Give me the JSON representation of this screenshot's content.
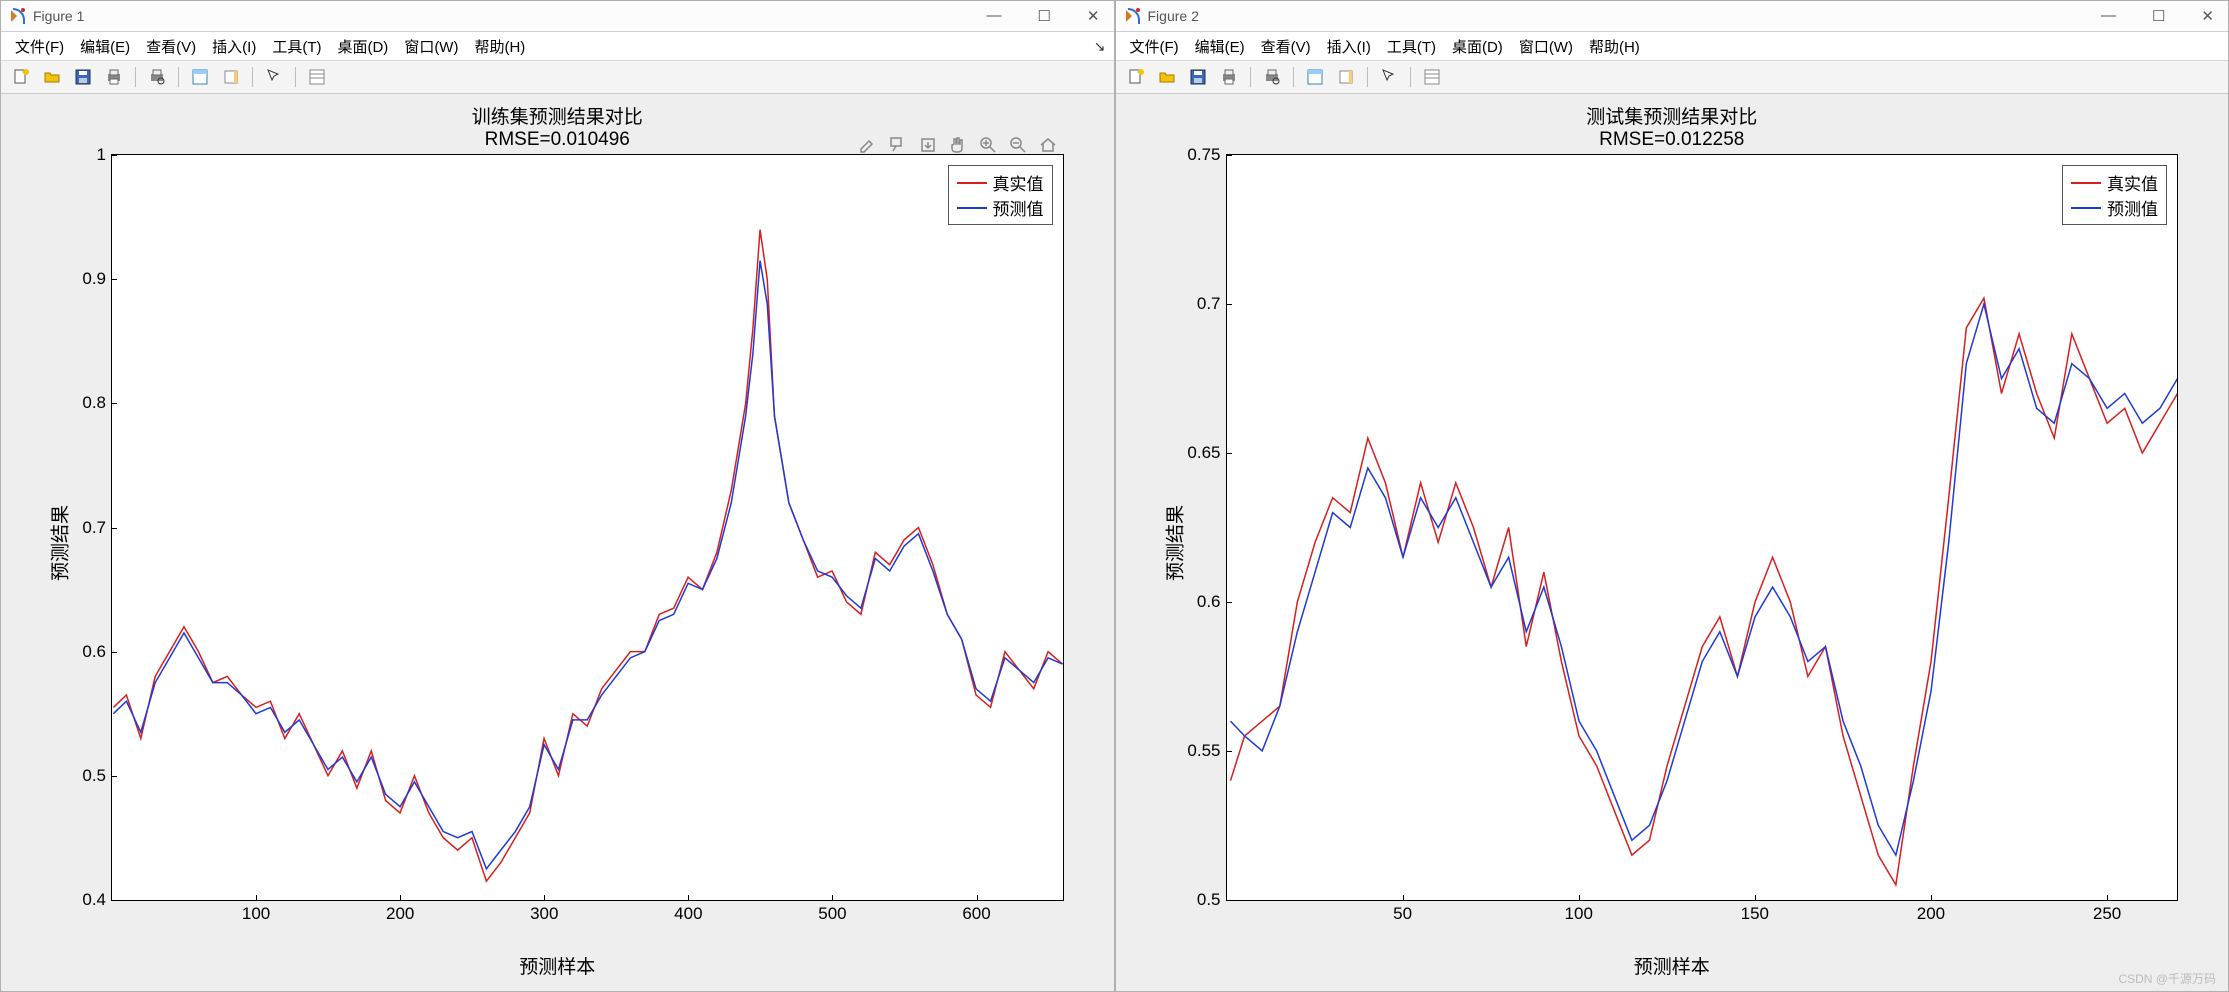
{
  "windows": [
    {
      "title": "Figure 1"
    },
    {
      "title": "Figure 2"
    }
  ],
  "menus": [
    "文件(F)",
    "编辑(E)",
    "查看(V)",
    "插入(I)",
    "工具(T)",
    "桌面(D)",
    "窗口(W)",
    "帮助(H)"
  ],
  "toolbar_icons": [
    "new-icon",
    "open-icon",
    "save-icon",
    "print-icon",
    "printpreview-icon",
    "linkeddata-icon",
    "colorbar-icon",
    "legend-icon",
    "arrow-icon",
    "properties-icon"
  ],
  "legend": {
    "real": "真实值",
    "pred": "预测值"
  },
  "colors": {
    "real": "#d81e1e",
    "pred": "#1e3ad8"
  },
  "watermark": "CSDN @千源万码",
  "chart_data": [
    {
      "type": "line",
      "title": "训练集预测结果对比",
      "subtitle": "RMSE=0.010496",
      "xlabel": "预测样本",
      "ylabel": "预测结果",
      "xlim": [
        0,
        660
      ],
      "ylim": [
        0.4,
        1.0
      ],
      "xticks": [
        100,
        200,
        300,
        400,
        500,
        600
      ],
      "yticks": [
        0.4,
        0.5,
        0.6,
        0.7,
        0.8,
        0.9,
        1.0
      ],
      "series": [
        {
          "name": "真实值",
          "x": [
            1,
            10,
            20,
            30,
            40,
            50,
            60,
            70,
            80,
            90,
            100,
            110,
            120,
            130,
            140,
            150,
            160,
            170,
            180,
            190,
            200,
            210,
            220,
            230,
            240,
            250,
            260,
            270,
            280,
            290,
            300,
            310,
            320,
            330,
            340,
            350,
            360,
            370,
            380,
            390,
            400,
            410,
            420,
            430,
            440,
            445,
            450,
            455,
            460,
            470,
            480,
            490,
            500,
            510,
            520,
            530,
            540,
            550,
            560,
            570,
            580,
            590,
            600,
            610,
            620,
            630,
            640,
            650,
            660
          ],
          "y": [
            0.555,
            0.565,
            0.53,
            0.58,
            0.6,
            0.62,
            0.6,
            0.575,
            0.58,
            0.565,
            0.555,
            0.56,
            0.53,
            0.55,
            0.525,
            0.5,
            0.52,
            0.49,
            0.52,
            0.48,
            0.47,
            0.5,
            0.47,
            0.45,
            0.44,
            0.45,
            0.415,
            0.43,
            0.45,
            0.47,
            0.53,
            0.5,
            0.55,
            0.54,
            0.57,
            0.585,
            0.6,
            0.6,
            0.63,
            0.635,
            0.66,
            0.65,
            0.68,
            0.73,
            0.8,
            0.86,
            0.94,
            0.9,
            0.79,
            0.72,
            0.69,
            0.66,
            0.665,
            0.64,
            0.63,
            0.68,
            0.67,
            0.69,
            0.7,
            0.67,
            0.63,
            0.61,
            0.565,
            0.555,
            0.6,
            0.585,
            0.57,
            0.6,
            0.59
          ]
        },
        {
          "name": "预测值",
          "x": [
            1,
            10,
            20,
            30,
            40,
            50,
            60,
            70,
            80,
            90,
            100,
            110,
            120,
            130,
            140,
            150,
            160,
            170,
            180,
            190,
            200,
            210,
            220,
            230,
            240,
            250,
            260,
            270,
            280,
            290,
            300,
            310,
            320,
            330,
            340,
            350,
            360,
            370,
            380,
            390,
            400,
            410,
            420,
            430,
            440,
            445,
            450,
            455,
            460,
            470,
            480,
            490,
            500,
            510,
            520,
            530,
            540,
            550,
            560,
            570,
            580,
            590,
            600,
            610,
            620,
            630,
            640,
            650,
            660
          ],
          "y": [
            0.55,
            0.56,
            0.535,
            0.575,
            0.595,
            0.615,
            0.595,
            0.575,
            0.575,
            0.565,
            0.55,
            0.555,
            0.535,
            0.545,
            0.525,
            0.505,
            0.515,
            0.495,
            0.515,
            0.485,
            0.475,
            0.495,
            0.475,
            0.455,
            0.45,
            0.455,
            0.425,
            0.44,
            0.455,
            0.475,
            0.525,
            0.505,
            0.545,
            0.545,
            0.565,
            0.58,
            0.595,
            0.6,
            0.625,
            0.63,
            0.655,
            0.65,
            0.675,
            0.72,
            0.79,
            0.84,
            0.915,
            0.88,
            0.79,
            0.72,
            0.69,
            0.665,
            0.66,
            0.645,
            0.635,
            0.675,
            0.665,
            0.685,
            0.695,
            0.665,
            0.63,
            0.61,
            0.57,
            0.56,
            0.595,
            0.585,
            0.575,
            0.595,
            0.59
          ]
        }
      ]
    },
    {
      "type": "line",
      "title": "测试集预测结果对比",
      "subtitle": "RMSE=0.012258",
      "xlabel": "预测样本",
      "ylabel": "预测结果",
      "xlim": [
        0,
        270
      ],
      "ylim": [
        0.5,
        0.75
      ],
      "xticks": [
        50,
        100,
        150,
        200,
        250
      ],
      "yticks": [
        0.5,
        0.55,
        0.6,
        0.65,
        0.7,
        0.75
      ],
      "series": [
        {
          "name": "真实值",
          "x": [
            1,
            5,
            10,
            15,
            20,
            25,
            30,
            35,
            40,
            45,
            50,
            55,
            60,
            65,
            70,
            75,
            80,
            85,
            90,
            95,
            100,
            105,
            110,
            115,
            120,
            125,
            130,
            135,
            140,
            145,
            150,
            155,
            160,
            165,
            170,
            175,
            180,
            185,
            190,
            195,
            200,
            205,
            210,
            215,
            220,
            225,
            230,
            235,
            240,
            245,
            250,
            255,
            260,
            265,
            270
          ],
          "y": [
            0.54,
            0.555,
            0.56,
            0.565,
            0.6,
            0.62,
            0.635,
            0.63,
            0.655,
            0.64,
            0.615,
            0.64,
            0.62,
            0.64,
            0.625,
            0.605,
            0.625,
            0.585,
            0.61,
            0.58,
            0.555,
            0.545,
            0.53,
            0.515,
            0.52,
            0.545,
            0.565,
            0.585,
            0.595,
            0.575,
            0.6,
            0.615,
            0.6,
            0.575,
            0.585,
            0.555,
            0.535,
            0.515,
            0.505,
            0.545,
            0.58,
            0.635,
            0.692,
            0.702,
            0.67,
            0.69,
            0.67,
            0.655,
            0.69,
            0.675,
            0.66,
            0.665,
            0.65,
            0.66,
            0.67
          ]
        },
        {
          "name": "预测值",
          "x": [
            1,
            5,
            10,
            15,
            20,
            25,
            30,
            35,
            40,
            45,
            50,
            55,
            60,
            65,
            70,
            75,
            80,
            85,
            90,
            95,
            100,
            105,
            110,
            115,
            120,
            125,
            130,
            135,
            140,
            145,
            150,
            155,
            160,
            165,
            170,
            175,
            180,
            185,
            190,
            195,
            200,
            205,
            210,
            215,
            220,
            225,
            230,
            235,
            240,
            245,
            250,
            255,
            260,
            265,
            270
          ],
          "y": [
            0.56,
            0.555,
            0.55,
            0.565,
            0.59,
            0.61,
            0.63,
            0.625,
            0.645,
            0.635,
            0.615,
            0.635,
            0.625,
            0.635,
            0.62,
            0.605,
            0.615,
            0.59,
            0.605,
            0.585,
            0.56,
            0.55,
            0.535,
            0.52,
            0.525,
            0.54,
            0.56,
            0.58,
            0.59,
            0.575,
            0.595,
            0.605,
            0.595,
            0.58,
            0.585,
            0.56,
            0.545,
            0.525,
            0.515,
            0.54,
            0.57,
            0.62,
            0.68,
            0.7,
            0.675,
            0.685,
            0.665,
            0.66,
            0.68,
            0.675,
            0.665,
            0.67,
            0.66,
            0.665,
            0.675
          ]
        }
      ]
    }
  ]
}
